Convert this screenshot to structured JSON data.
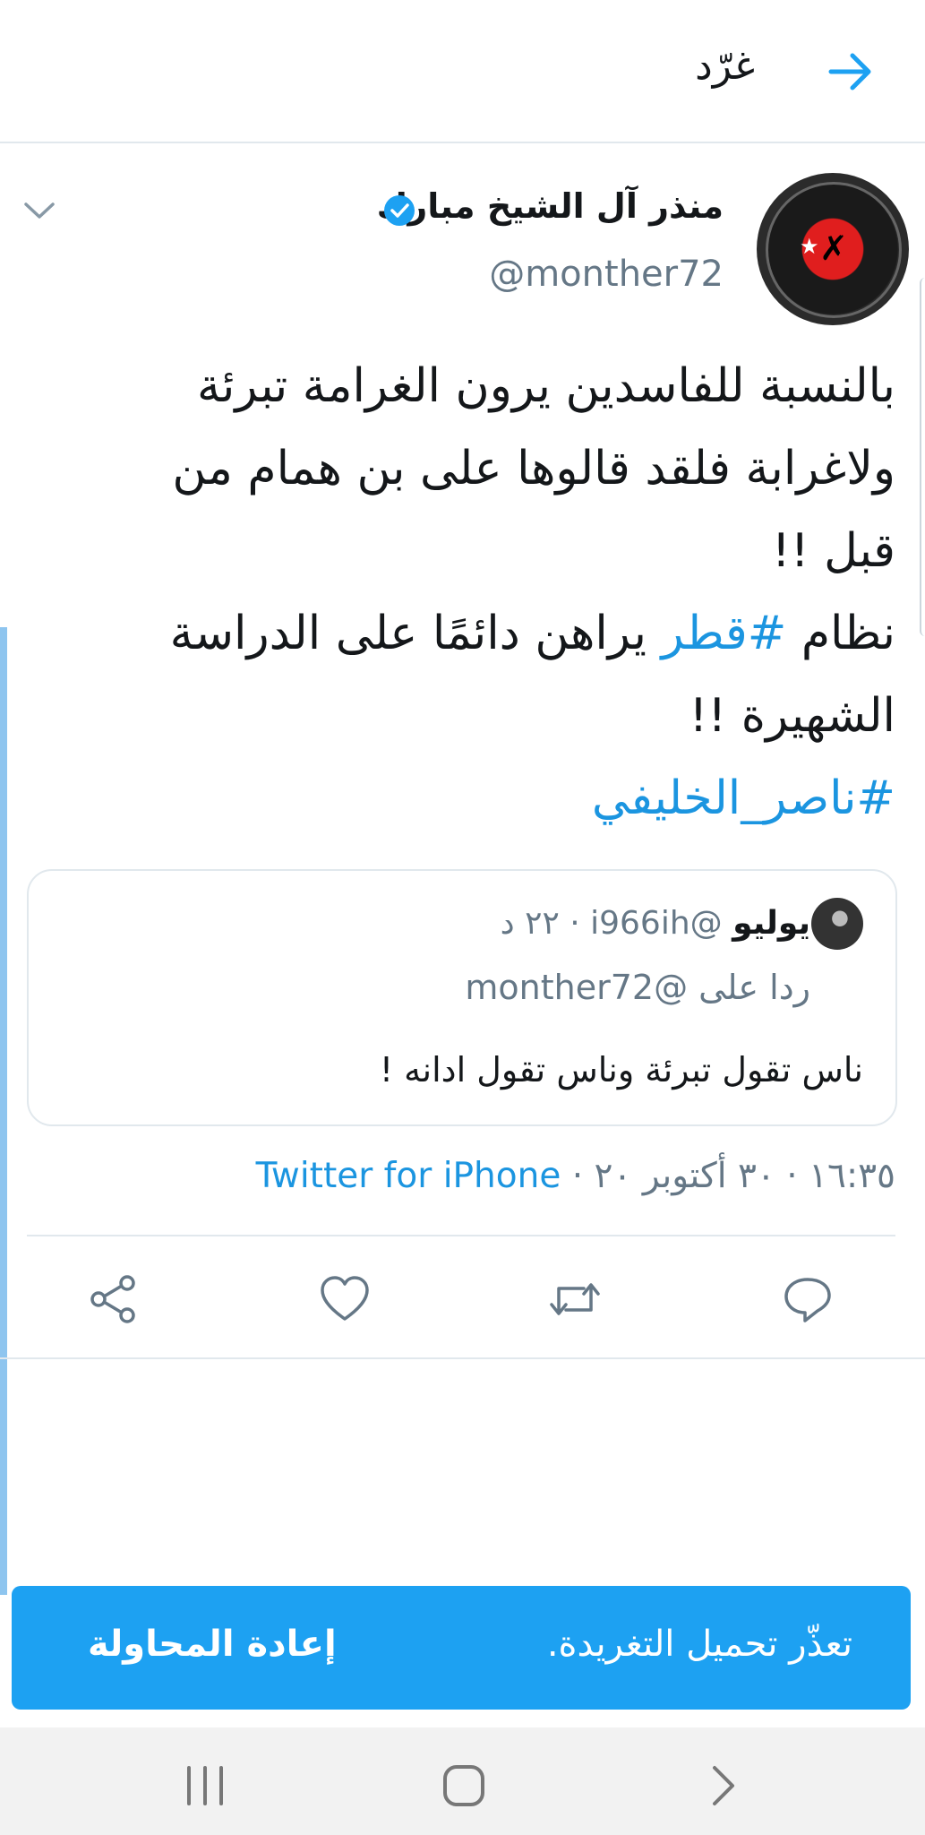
{
  "header": {
    "title": "غرّد"
  },
  "tweet": {
    "display_name": "منذر آل الشيخ مبارك",
    "handle": "@monther72",
    "text_part1": "بالنسبة للفاسدين يرون الغرامة تبرئة ولاغرابة فلقد قالوها على بن همام من قبل !!\nنظام ",
    "hashtag1": "#قطر",
    "text_part2": " يراهن دائمًا على الدراسة الشهيرة !!\n",
    "hashtag2": "#ناصر_الخليفي",
    "timestamp": "١٦:٣٥ · ٣٠ أكتوبر ٢٠ · ",
    "source": "Twitter for iPhone"
  },
  "quoted": {
    "name": "يوليو",
    "handle": "@i966ih",
    "time": "· ٢٢ د",
    "reply_to": "ردا على @monther72",
    "text": "ناس تقول تبرئة وناس تقول ادانه !"
  },
  "toast": {
    "message": "تعذّر تحميل التغريدة.",
    "retry_label": "إعادة المحاولة"
  },
  "colors": {
    "accent": "#1da1f2",
    "link": "#1b95e0",
    "muted": "#657786"
  },
  "icons": [
    "back-arrow-icon",
    "verified-icon",
    "chevron-down-icon",
    "reply-icon",
    "retweet-icon",
    "like-icon",
    "share-icon",
    "recent-apps-icon",
    "home-icon",
    "back-icon"
  ]
}
